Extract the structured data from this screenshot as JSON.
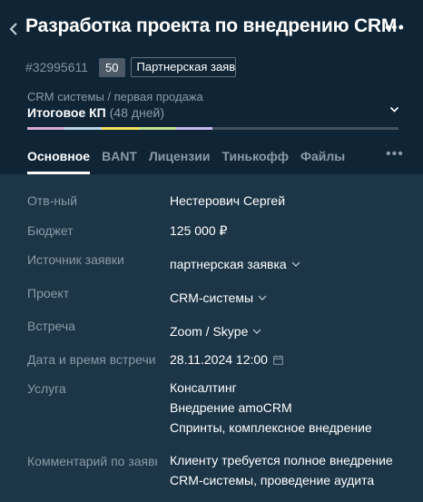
{
  "header": {
    "title": "Разработка проекта по внедрению CRM",
    "deal_id": "#32995611",
    "score": "50",
    "tag": "Партнерская заявка",
    "pipeline": "CRM системы / первая продажа",
    "stage": "Итоговое КП",
    "stage_days": "(48 дней)",
    "progress": [
      {
        "color": "#d9a8d6",
        "share": 0.1
      },
      {
        "color": "#b9d6e6",
        "share": 0.1
      },
      {
        "color": "#f5e35b",
        "share": 0.1
      },
      {
        "color": "#c7e38e",
        "share": 0.1
      },
      {
        "color": "#c7b8f0",
        "share": 0.1
      },
      {
        "color": "#44525e",
        "share": 0.5
      }
    ]
  },
  "tabs": [
    {
      "label": "Основное",
      "active": true
    },
    {
      "label": "BANT",
      "active": false
    },
    {
      "label": "Лицензии",
      "active": false
    },
    {
      "label": "Тинькофф",
      "active": false
    },
    {
      "label": "Файлы",
      "active": false
    }
  ],
  "fields": {
    "responsible": {
      "label": "Отв-ный",
      "value": "Нестерович Сергей"
    },
    "budget": {
      "label": "Бюджет",
      "value": "125 000 ₽"
    },
    "lead_source": {
      "label": "Источник заявки",
      "value": "партнерская заявка"
    },
    "project": {
      "label": "Проект",
      "value": "CRM-системы"
    },
    "meeting": {
      "label": "Встреча",
      "value": "Zoom / Skype"
    },
    "meeting_datetime": {
      "label": "Дата и время встречи",
      "value": "28.11.2024 12:00"
    },
    "service": {
      "label": "Услуга",
      "values": [
        "Консалтинг",
        "Внедрение amoCRM",
        "Спринты, комплексное внедрение"
      ]
    },
    "comment": {
      "label": "Комментарий по заявке",
      "lines": [
        "Клиенту требуется полное внедрение",
        "CRM-системы, проведение аудита"
      ]
    }
  },
  "icons": {
    "back": "chevron-left-icon",
    "more": "ellipsis-icon",
    "stage_toggle": "chevron-down-icon",
    "dropdown": "caret-down-icon",
    "calendar": "calendar-icon"
  }
}
